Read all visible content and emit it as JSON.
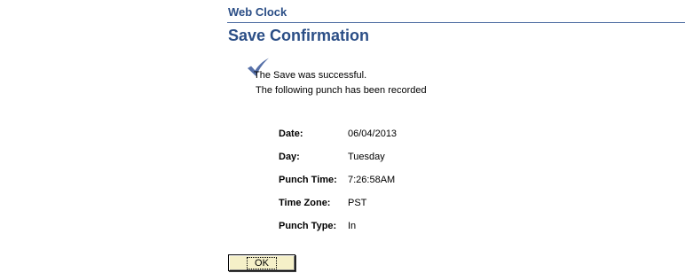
{
  "header": {
    "app_title": "Web Clock",
    "page_title": "Save Confirmation"
  },
  "confirmation": {
    "icon": "checkmark-icon",
    "success_message": "The Save was successful.",
    "recorded_message": "The following punch has been recorded"
  },
  "punch_details": [
    {
      "label": "Date:",
      "value": "06/04/2013"
    },
    {
      "label": "Day:",
      "value": "Tuesday"
    },
    {
      "label": "Punch Time:",
      "value": "7:26:58AM"
    },
    {
      "label": "Time Zone:",
      "value": "PST"
    },
    {
      "label": "Punch Type:",
      "value": "In"
    }
  ],
  "actions": {
    "ok_label": "OK"
  },
  "colors": {
    "header_text": "#2b4e86",
    "rule": "#4a6aa0",
    "check_icon": "#5670a8",
    "button_bg": "#f5f0c8"
  }
}
